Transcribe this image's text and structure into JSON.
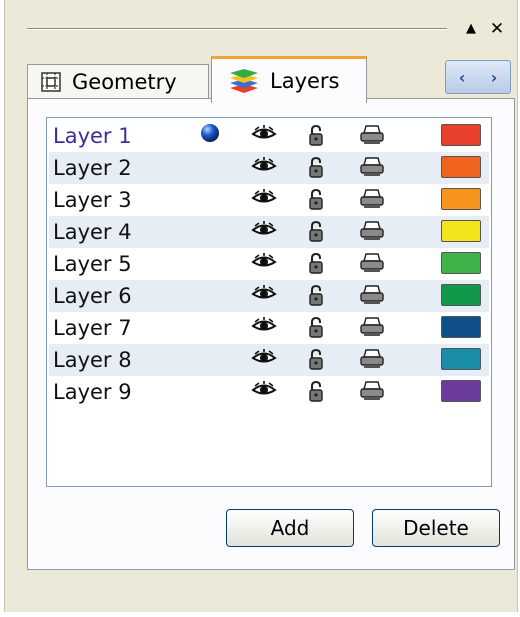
{
  "titlebar": {
    "pin_glyph": "▲",
    "close_glyph": "✕"
  },
  "tabs": [
    {
      "label": "Geometry",
      "icon": "geometry-grid-icon",
      "selected": false
    },
    {
      "label": "Layers",
      "icon": "layers-stack-icon",
      "selected": true
    }
  ],
  "tab_nav": {
    "prev_glyph": "‹",
    "next_glyph": "›"
  },
  "layers": [
    {
      "name": "Layer 1",
      "current": true,
      "color": "#e8402a"
    },
    {
      "name": "Layer 2",
      "current": false,
      "color": "#f0641e"
    },
    {
      "name": "Layer 3",
      "current": false,
      "color": "#f7941d"
    },
    {
      "name": "Layer 4",
      "current": false,
      "color": "#f2e51c"
    },
    {
      "name": "Layer 5",
      "current": false,
      "color": "#3fb24a"
    },
    {
      "name": "Layer 6",
      "current": false,
      "color": "#12984a"
    },
    {
      "name": "Layer 7",
      "current": false,
      "color": "#0f4f8a"
    },
    {
      "name": "Layer 8",
      "current": false,
      "color": "#1a8ea8"
    },
    {
      "name": "Layer 9",
      "current": false,
      "color": "#6a3b9c"
    }
  ],
  "buttons": {
    "add_label": "Add",
    "delete_label": "Delete"
  }
}
